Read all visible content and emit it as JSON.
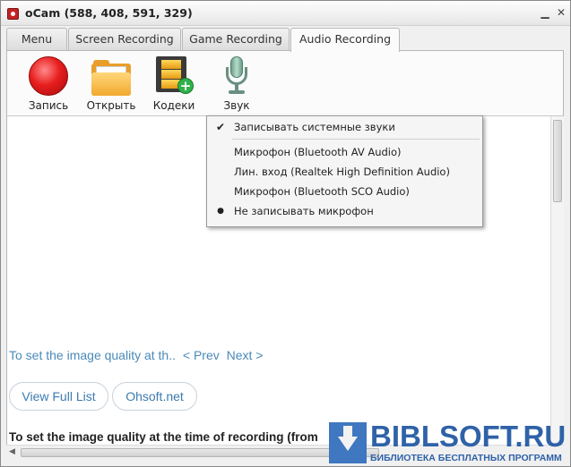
{
  "window": {
    "title": "oCam (588, 408, 591, 329)"
  },
  "tabs": [
    {
      "label": "Menu"
    },
    {
      "label": "Screen Recording"
    },
    {
      "label": "Game Recording"
    },
    {
      "label": "Audio Recording"
    }
  ],
  "active_tab": "Audio Recording",
  "toolbar": {
    "record_label": "Запись",
    "open_label": "Открыть",
    "codecs_label": "Кодеки",
    "sound_label": "Звук"
  },
  "sound_menu": {
    "items": [
      {
        "label": "Записывать системные звуки",
        "mark": "✔"
      },
      {
        "label": "Микрофон (Bluetooth AV Audio)",
        "mark": ""
      },
      {
        "label": "Лин. вход (Realtek High Definition Audio)",
        "mark": ""
      },
      {
        "label": "Микрофон (Bluetooth SCO Audio)",
        "mark": ""
      },
      {
        "label": "Не записывать микрофон",
        "mark": "●"
      }
    ]
  },
  "content": {
    "link_text": "To set the image quality at th..",
    "prev_label": "< Prev",
    "next_label": "Next >",
    "view_full_list_label": "View Full List",
    "ohsoft_label": "Ohsoft.net",
    "bold_line": "To set the image quality at the time of recording (from"
  },
  "watermark": {
    "title": "BIBLSOFT.RU",
    "subtitle": "БИБЛИОТЕКА БЕСПЛАТНЫХ ПРОГРАММ"
  },
  "colors": {
    "link": "#4a8ab8",
    "watermark": "#2f62a8",
    "record": "#e81e1e"
  }
}
